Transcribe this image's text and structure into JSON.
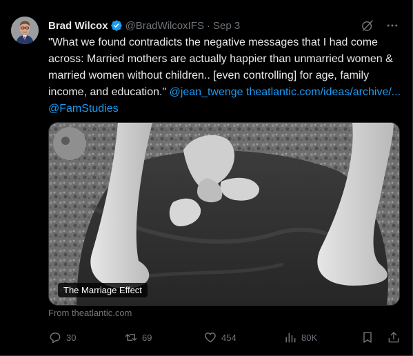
{
  "tweet": {
    "author_name": "Brad Wilcox",
    "author_handle": "@BradWilcoxIFS",
    "separator": "·",
    "date": "Sep 3",
    "text_main": "\"What we found contradicts the negative messages that I had come across: Married mothers are actually happier than unmarried women & married women without children.. [even controlling] for age, family income, and education.\"",
    "mention_1": "@jean_twenge",
    "link_text": "theatlantic.com/ideas/archive/...",
    "mention_2": "@FamStudies",
    "media_label": "The Marriage Effect",
    "source_text": "From theatlantic.com"
  },
  "actions": {
    "replies": "30",
    "retweets": "69",
    "likes": "454",
    "views": "80K"
  },
  "icons": {
    "verified": "verified-badge-icon",
    "grok": "grok-icon",
    "more": "more-icon",
    "reply": "reply-icon",
    "retweet": "retweet-icon",
    "like": "heart-icon",
    "views": "views-icon",
    "bookmark": "bookmark-icon",
    "share": "share-icon"
  },
  "colors": {
    "background": "#000000",
    "text": "#e7e9ea",
    "muted": "#71767b",
    "link": "#1d9bf0",
    "verified": "#1d9bf0"
  }
}
